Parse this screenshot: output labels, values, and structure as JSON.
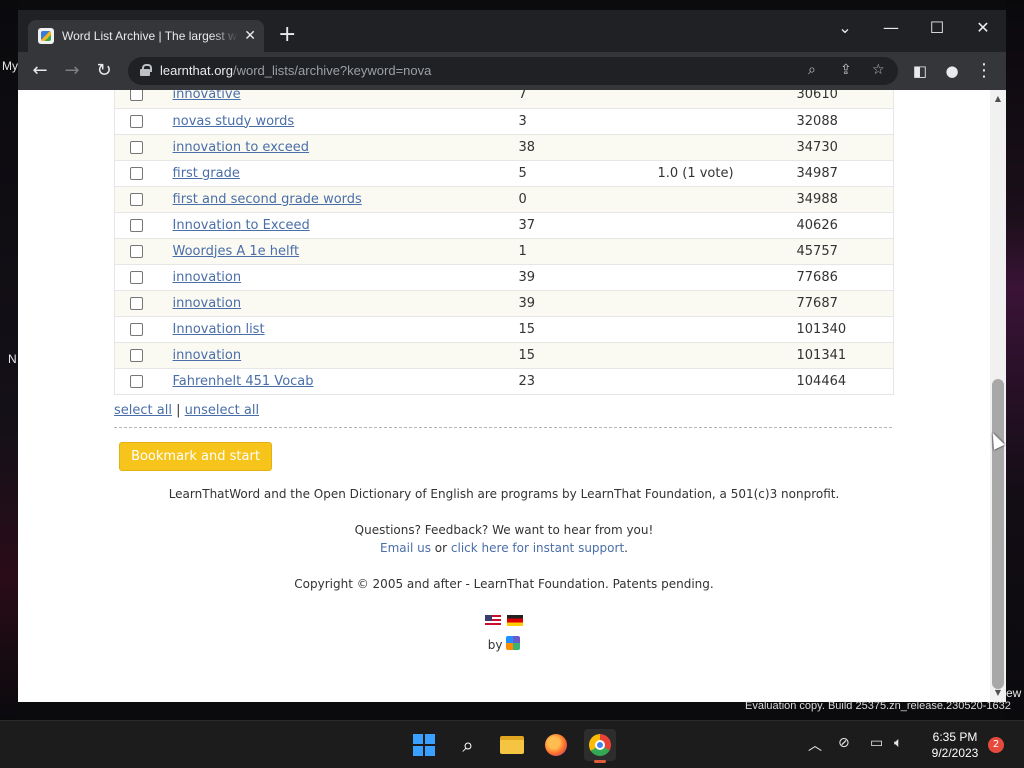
{
  "desktop": {
    "left_labels": [
      "My",
      "N"
    ],
    "right_label": "ew",
    "watermark": "Evaluation copy. Build 25375.zn_release.230520-1632"
  },
  "browser": {
    "tab_title": "Word List Archive | The largest word list archive",
    "tab_close": "✕",
    "new_tab": "+",
    "window_controls": {
      "dropdown": "⌄",
      "minimize": "—",
      "maximize": "☐",
      "close": "✕"
    },
    "url_host": "learnthat.org",
    "url_path": "/word_lists/archive?keyword=nova"
  },
  "table": {
    "rows": [
      {
        "name": "innovative",
        "count": "7",
        "rating": "",
        "id": "30610"
      },
      {
        "name": "novas study words",
        "count": "3",
        "rating": "",
        "id": "32088"
      },
      {
        "name": "innovation to exceed",
        "count": "38",
        "rating": "",
        "id": "34730"
      },
      {
        "name": "first grade",
        "count": "5",
        "rating": "1.0 (1 vote)",
        "id": "34987"
      },
      {
        "name": "first and second grade words",
        "count": "0",
        "rating": "",
        "id": "34988"
      },
      {
        "name": "Innovation to Exceed",
        "count": "37",
        "rating": "",
        "id": "40626"
      },
      {
        "name": "Woordjes A 1e helft",
        "count": "1",
        "rating": "",
        "id": "45757"
      },
      {
        "name": "innovation",
        "count": "39",
        "rating": "",
        "id": "77686"
      },
      {
        "name": "innovation",
        "count": "39",
        "rating": "",
        "id": "77687"
      },
      {
        "name": "Innovation list",
        "count": "15",
        "rating": "",
        "id": "101340"
      },
      {
        "name": "innovation",
        "count": "15",
        "rating": "",
        "id": "101341"
      },
      {
        "name": "Fahrenhelt 451 Vocab",
        "count": "23",
        "rating": "",
        "id": "104464"
      }
    ]
  },
  "selection": {
    "select_all": "select all",
    "separator": "|",
    "unselect_all": "unselect all"
  },
  "bookmark_button": "Bookmark and start",
  "footer": {
    "line1": "LearnThatWord and the Open Dictionary of English are programs by LearnThat Foundation, a 501(c)3 nonprofit.",
    "line2": "Questions? Feedback? We want to hear from you!",
    "email_link": "Email us",
    "or": "or",
    "support_link": "click here for instant support",
    "period": ".",
    "copyright": "Copyright © 2005 and after - LearnThat Foundation. Patents pending.",
    "by": "by"
  },
  "taskbar": {
    "time": "6:35 PM",
    "date": "9/2/2023",
    "notifications": "2"
  }
}
